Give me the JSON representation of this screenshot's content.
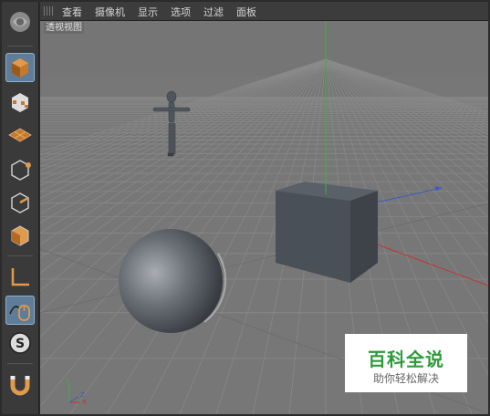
{
  "menu": {
    "items": [
      "查看",
      "摄像机",
      "显示",
      "选项",
      "过滤",
      "面板"
    ]
  },
  "viewport": {
    "label": "透视视图"
  },
  "toolbar": {
    "tools": [
      "cube-tool",
      "checker-cube-tool",
      "grid-plane-tool",
      "point-mode-tool",
      "edge-mode-tool",
      "polygon-mode-tool",
      "axis-mode-tool",
      "mouse-tool",
      "snap-s-tool",
      "magnet-tool"
    ]
  },
  "watermark": {
    "title": "百科全说",
    "subtitle": "助你轻松解决"
  },
  "colors": {
    "viewport_bg": "#777777",
    "grid": "#888888",
    "axis_y": "#3cb043",
    "axis_x": "#c83232",
    "axis_z": "#3a5cc8",
    "active_tool": "#5f7c98"
  }
}
